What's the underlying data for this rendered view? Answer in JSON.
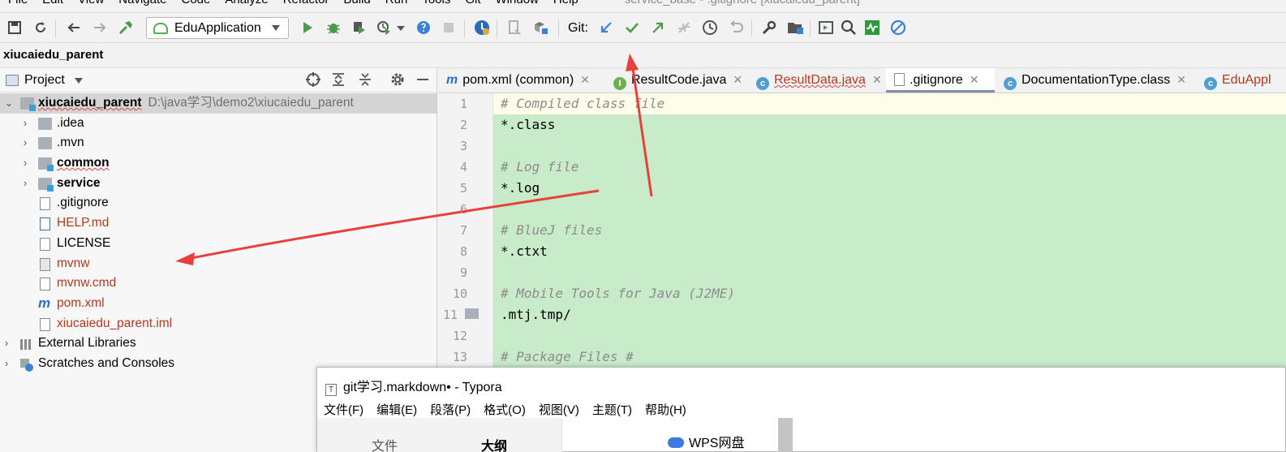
{
  "menubar": {
    "items": [
      "File",
      "Edit",
      "View",
      "Navigate",
      "Code",
      "Analyze",
      "Refactor",
      "Build",
      "Run",
      "Tools",
      "Git",
      "Window",
      "Help"
    ],
    "window_title": "service_base - .gitignore [xiucaiedu_parent]"
  },
  "toolbar": {
    "run_config": "EduApplication",
    "git_label": "Git:",
    "colors": {
      "green": "#4c9a4c",
      "blue": "#3b82d6"
    }
  },
  "project_title": "xiucaiedu_parent",
  "project_panel": {
    "title": "Project",
    "tree": [
      {
        "name": "xiucaiedu_parent",
        "path": "D:\\java学习\\demo2\\xiucaiedu_parent",
        "type": "module-root"
      },
      {
        "name": ".idea",
        "type": "folder"
      },
      {
        "name": ".mvn",
        "type": "folder"
      },
      {
        "name": "common",
        "type": "module"
      },
      {
        "name": "service",
        "type": "module"
      },
      {
        "name": ".gitignore",
        "type": "file"
      },
      {
        "name": "HELP.md",
        "type": "md"
      },
      {
        "name": "LICENSE",
        "type": "text"
      },
      {
        "name": "mvnw",
        "type": "script"
      },
      {
        "name": "mvnw.cmd",
        "type": "file"
      },
      {
        "name": "pom.xml",
        "type": "maven"
      },
      {
        "name": "xiucaiedu_parent.iml",
        "type": "iml"
      },
      {
        "name": "External Libraries",
        "type": "libraries"
      },
      {
        "name": "Scratches and Consoles",
        "type": "scratches"
      }
    ]
  },
  "editor": {
    "tabs": [
      {
        "label": "pom.xml (common)",
        "icon": "maven-icon"
      },
      {
        "label": "ResultCode.java",
        "icon": "interface-icon"
      },
      {
        "label": "ResultData.java",
        "icon": "class-icon"
      },
      {
        "label": ".gitignore",
        "icon": "gitignore-icon"
      },
      {
        "label": "DocumentationType.class",
        "icon": "class-icon"
      },
      {
        "label": "EduAppl",
        "icon": "class-run-icon"
      }
    ],
    "lines": [
      {
        "n": "1",
        "text": "# Compiled class file",
        "comment": true
      },
      {
        "n": "2",
        "text": "*.class",
        "comment": false
      },
      {
        "n": "3",
        "text": "",
        "comment": false
      },
      {
        "n": "4",
        "text": "# Log file",
        "comment": true
      },
      {
        "n": "5",
        "text": "*.log",
        "comment": false
      },
      {
        "n": "6",
        "text": "",
        "comment": false
      },
      {
        "n": "7",
        "text": "# BlueJ files",
        "comment": true
      },
      {
        "n": "8",
        "text": "*.ctxt",
        "comment": false
      },
      {
        "n": "9",
        "text": "",
        "comment": false
      },
      {
        "n": "10",
        "text": "# Mobile Tools for Java (J2ME)",
        "comment": true
      },
      {
        "n": "11",
        "text": ".mtj.tmp/",
        "comment": false
      },
      {
        "n": "12",
        "text": "",
        "comment": false
      },
      {
        "n": "13",
        "text": "# Package Files #",
        "comment": true
      }
    ],
    "added_background": "#c8ebc9"
  },
  "typora": {
    "title": "git学习.markdown• - Typora",
    "icon_letter": "T",
    "menu": [
      "文件(F)",
      "编辑(E)",
      "段落(P)",
      "格式(O)",
      "视图(V)",
      "主题(T)",
      "帮助(H)"
    ],
    "sidebar_tabs": [
      "文件",
      "大纲"
    ],
    "wps_label": "WPS网盘"
  },
  "annotation_color": "#e8403a"
}
